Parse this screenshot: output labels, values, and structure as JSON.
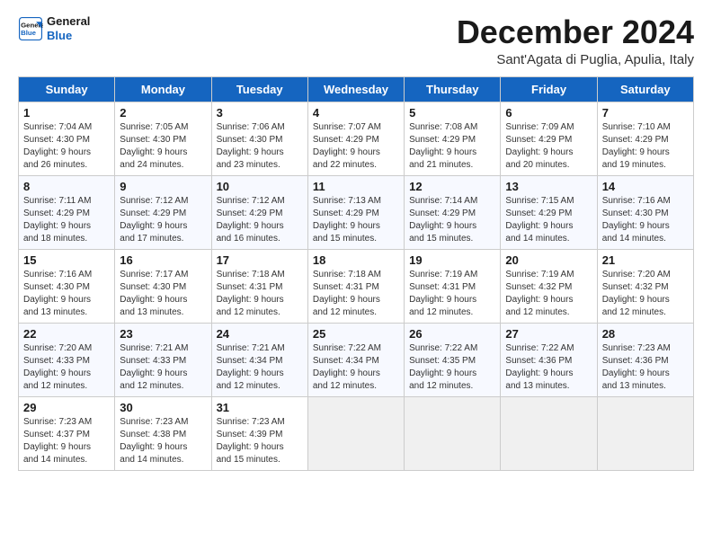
{
  "logo": {
    "line1": "General",
    "line2": "Blue"
  },
  "title": "December 2024",
  "subtitle": "Sant'Agata di Puglia, Apulia, Italy",
  "weekdays": [
    "Sunday",
    "Monday",
    "Tuesday",
    "Wednesday",
    "Thursday",
    "Friday",
    "Saturday"
  ],
  "weeks": [
    [
      {
        "day": "1",
        "info": "Sunrise: 7:04 AM\nSunset: 4:30 PM\nDaylight: 9 hours\nand 26 minutes."
      },
      {
        "day": "2",
        "info": "Sunrise: 7:05 AM\nSunset: 4:30 PM\nDaylight: 9 hours\nand 24 minutes."
      },
      {
        "day": "3",
        "info": "Sunrise: 7:06 AM\nSunset: 4:30 PM\nDaylight: 9 hours\nand 23 minutes."
      },
      {
        "day": "4",
        "info": "Sunrise: 7:07 AM\nSunset: 4:29 PM\nDaylight: 9 hours\nand 22 minutes."
      },
      {
        "day": "5",
        "info": "Sunrise: 7:08 AM\nSunset: 4:29 PM\nDaylight: 9 hours\nand 21 minutes."
      },
      {
        "day": "6",
        "info": "Sunrise: 7:09 AM\nSunset: 4:29 PM\nDaylight: 9 hours\nand 20 minutes."
      },
      {
        "day": "7",
        "info": "Sunrise: 7:10 AM\nSunset: 4:29 PM\nDaylight: 9 hours\nand 19 minutes."
      }
    ],
    [
      {
        "day": "8",
        "info": "Sunrise: 7:11 AM\nSunset: 4:29 PM\nDaylight: 9 hours\nand 18 minutes."
      },
      {
        "day": "9",
        "info": "Sunrise: 7:12 AM\nSunset: 4:29 PM\nDaylight: 9 hours\nand 17 minutes."
      },
      {
        "day": "10",
        "info": "Sunrise: 7:12 AM\nSunset: 4:29 PM\nDaylight: 9 hours\nand 16 minutes."
      },
      {
        "day": "11",
        "info": "Sunrise: 7:13 AM\nSunset: 4:29 PM\nDaylight: 9 hours\nand 15 minutes."
      },
      {
        "day": "12",
        "info": "Sunrise: 7:14 AM\nSunset: 4:29 PM\nDaylight: 9 hours\nand 15 minutes."
      },
      {
        "day": "13",
        "info": "Sunrise: 7:15 AM\nSunset: 4:29 PM\nDaylight: 9 hours\nand 14 minutes."
      },
      {
        "day": "14",
        "info": "Sunrise: 7:16 AM\nSunset: 4:30 PM\nDaylight: 9 hours\nand 14 minutes."
      }
    ],
    [
      {
        "day": "15",
        "info": "Sunrise: 7:16 AM\nSunset: 4:30 PM\nDaylight: 9 hours\nand 13 minutes."
      },
      {
        "day": "16",
        "info": "Sunrise: 7:17 AM\nSunset: 4:30 PM\nDaylight: 9 hours\nand 13 minutes."
      },
      {
        "day": "17",
        "info": "Sunrise: 7:18 AM\nSunset: 4:31 PM\nDaylight: 9 hours\nand 12 minutes."
      },
      {
        "day": "18",
        "info": "Sunrise: 7:18 AM\nSunset: 4:31 PM\nDaylight: 9 hours\nand 12 minutes."
      },
      {
        "day": "19",
        "info": "Sunrise: 7:19 AM\nSunset: 4:31 PM\nDaylight: 9 hours\nand 12 minutes."
      },
      {
        "day": "20",
        "info": "Sunrise: 7:19 AM\nSunset: 4:32 PM\nDaylight: 9 hours\nand 12 minutes."
      },
      {
        "day": "21",
        "info": "Sunrise: 7:20 AM\nSunset: 4:32 PM\nDaylight: 9 hours\nand 12 minutes."
      }
    ],
    [
      {
        "day": "22",
        "info": "Sunrise: 7:20 AM\nSunset: 4:33 PM\nDaylight: 9 hours\nand 12 minutes."
      },
      {
        "day": "23",
        "info": "Sunrise: 7:21 AM\nSunset: 4:33 PM\nDaylight: 9 hours\nand 12 minutes."
      },
      {
        "day": "24",
        "info": "Sunrise: 7:21 AM\nSunset: 4:34 PM\nDaylight: 9 hours\nand 12 minutes."
      },
      {
        "day": "25",
        "info": "Sunrise: 7:22 AM\nSunset: 4:34 PM\nDaylight: 9 hours\nand 12 minutes."
      },
      {
        "day": "26",
        "info": "Sunrise: 7:22 AM\nSunset: 4:35 PM\nDaylight: 9 hours\nand 12 minutes."
      },
      {
        "day": "27",
        "info": "Sunrise: 7:22 AM\nSunset: 4:36 PM\nDaylight: 9 hours\nand 13 minutes."
      },
      {
        "day": "28",
        "info": "Sunrise: 7:23 AM\nSunset: 4:36 PM\nDaylight: 9 hours\nand 13 minutes."
      }
    ],
    [
      {
        "day": "29",
        "info": "Sunrise: 7:23 AM\nSunset: 4:37 PM\nDaylight: 9 hours\nand 14 minutes."
      },
      {
        "day": "30",
        "info": "Sunrise: 7:23 AM\nSunset: 4:38 PM\nDaylight: 9 hours\nand 14 minutes."
      },
      {
        "day": "31",
        "info": "Sunrise: 7:23 AM\nSunset: 4:39 PM\nDaylight: 9 hours\nand 15 minutes."
      },
      null,
      null,
      null,
      null
    ]
  ]
}
